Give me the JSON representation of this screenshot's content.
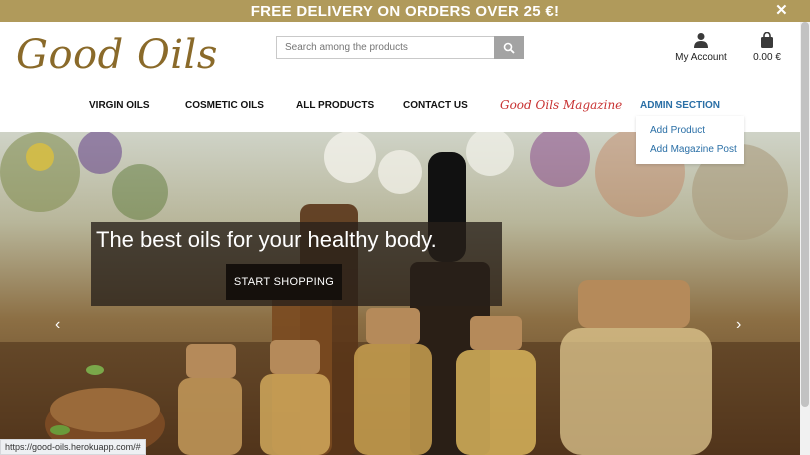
{
  "banner": {
    "text": "FREE DELIVERY ON ORDERS OVER 25 €!",
    "close": "✕"
  },
  "header": {
    "logo": "Good Oils",
    "search_placeholder": "Search among the products",
    "account_label": "My Account",
    "cart_total": "0.00 €"
  },
  "nav": {
    "items": [
      "VIRGIN OILS",
      "COSMETIC OILS",
      "ALL PRODUCTS",
      "CONTACT US"
    ],
    "magazine": "Good Oils Magazine",
    "admin": "ADMIN SECTION"
  },
  "admin_menu": {
    "items": [
      "Add Product",
      "Add Magazine Post"
    ]
  },
  "hero": {
    "title": "The best oils for your healthy body.",
    "button": "START SHOPPING"
  },
  "status_url": "https://good-oils.herokuapp.com/#",
  "colors": {
    "banner": "#b09a5b",
    "logo": "#8a6a2a",
    "magazine": "#c83232",
    "admin": "#2a6fa6"
  }
}
